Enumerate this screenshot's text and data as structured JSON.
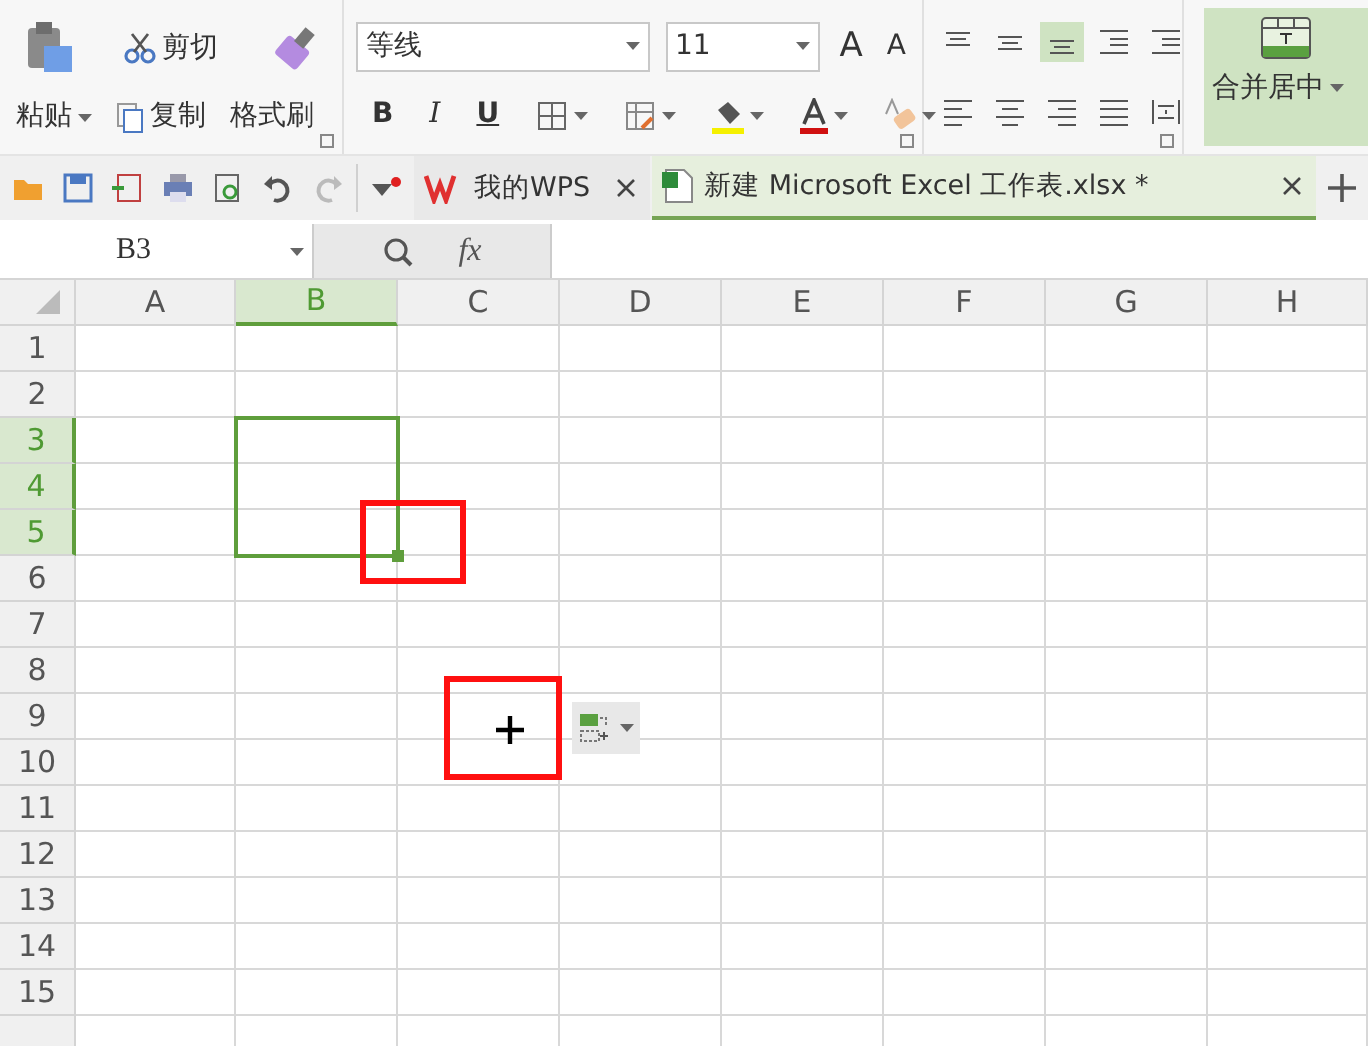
{
  "ribbon": {
    "paste": "粘贴",
    "cut": "剪切",
    "copy": "复制",
    "format_painter": "格式刷",
    "font_name": "等线",
    "font_size": "11",
    "bold": "B",
    "italic": "I",
    "underline": "U",
    "grow_font": "A",
    "shrink_font": "A",
    "merge_center": "合并居中"
  },
  "tabs": [
    {
      "label": "我的WPS",
      "selected": false
    },
    {
      "label": "新建 Microsoft Excel 工作表.xlsx *",
      "selected": true
    }
  ],
  "formula_bar": {
    "name_box": "B3",
    "fx": "fx"
  },
  "sheet": {
    "columns": [
      {
        "label": "A",
        "selected": false
      },
      {
        "label": "B",
        "selected": true
      },
      {
        "label": "C",
        "selected": false
      },
      {
        "label": "D",
        "selected": false
      },
      {
        "label": "E",
        "selected": false
      },
      {
        "label": "F",
        "selected": false
      },
      {
        "label": "G",
        "selected": false
      },
      {
        "label": "H",
        "selected": false
      }
    ],
    "rows": [
      {
        "label": "1",
        "selected": false
      },
      {
        "label": "2",
        "selected": false
      },
      {
        "label": "3",
        "selected": true
      },
      {
        "label": "4",
        "selected": true
      },
      {
        "label": "5",
        "selected": true
      },
      {
        "label": "6",
        "selected": false
      },
      {
        "label": "7",
        "selected": false
      },
      {
        "label": "8",
        "selected": false
      },
      {
        "label": "9",
        "selected": false
      },
      {
        "label": "10",
        "selected": false
      },
      {
        "label": "11",
        "selected": false
      },
      {
        "label": "12",
        "selected": false
      },
      {
        "label": "13",
        "selected": false
      },
      {
        "label": "14",
        "selected": false
      },
      {
        "label": "15",
        "selected": false
      }
    ]
  }
}
